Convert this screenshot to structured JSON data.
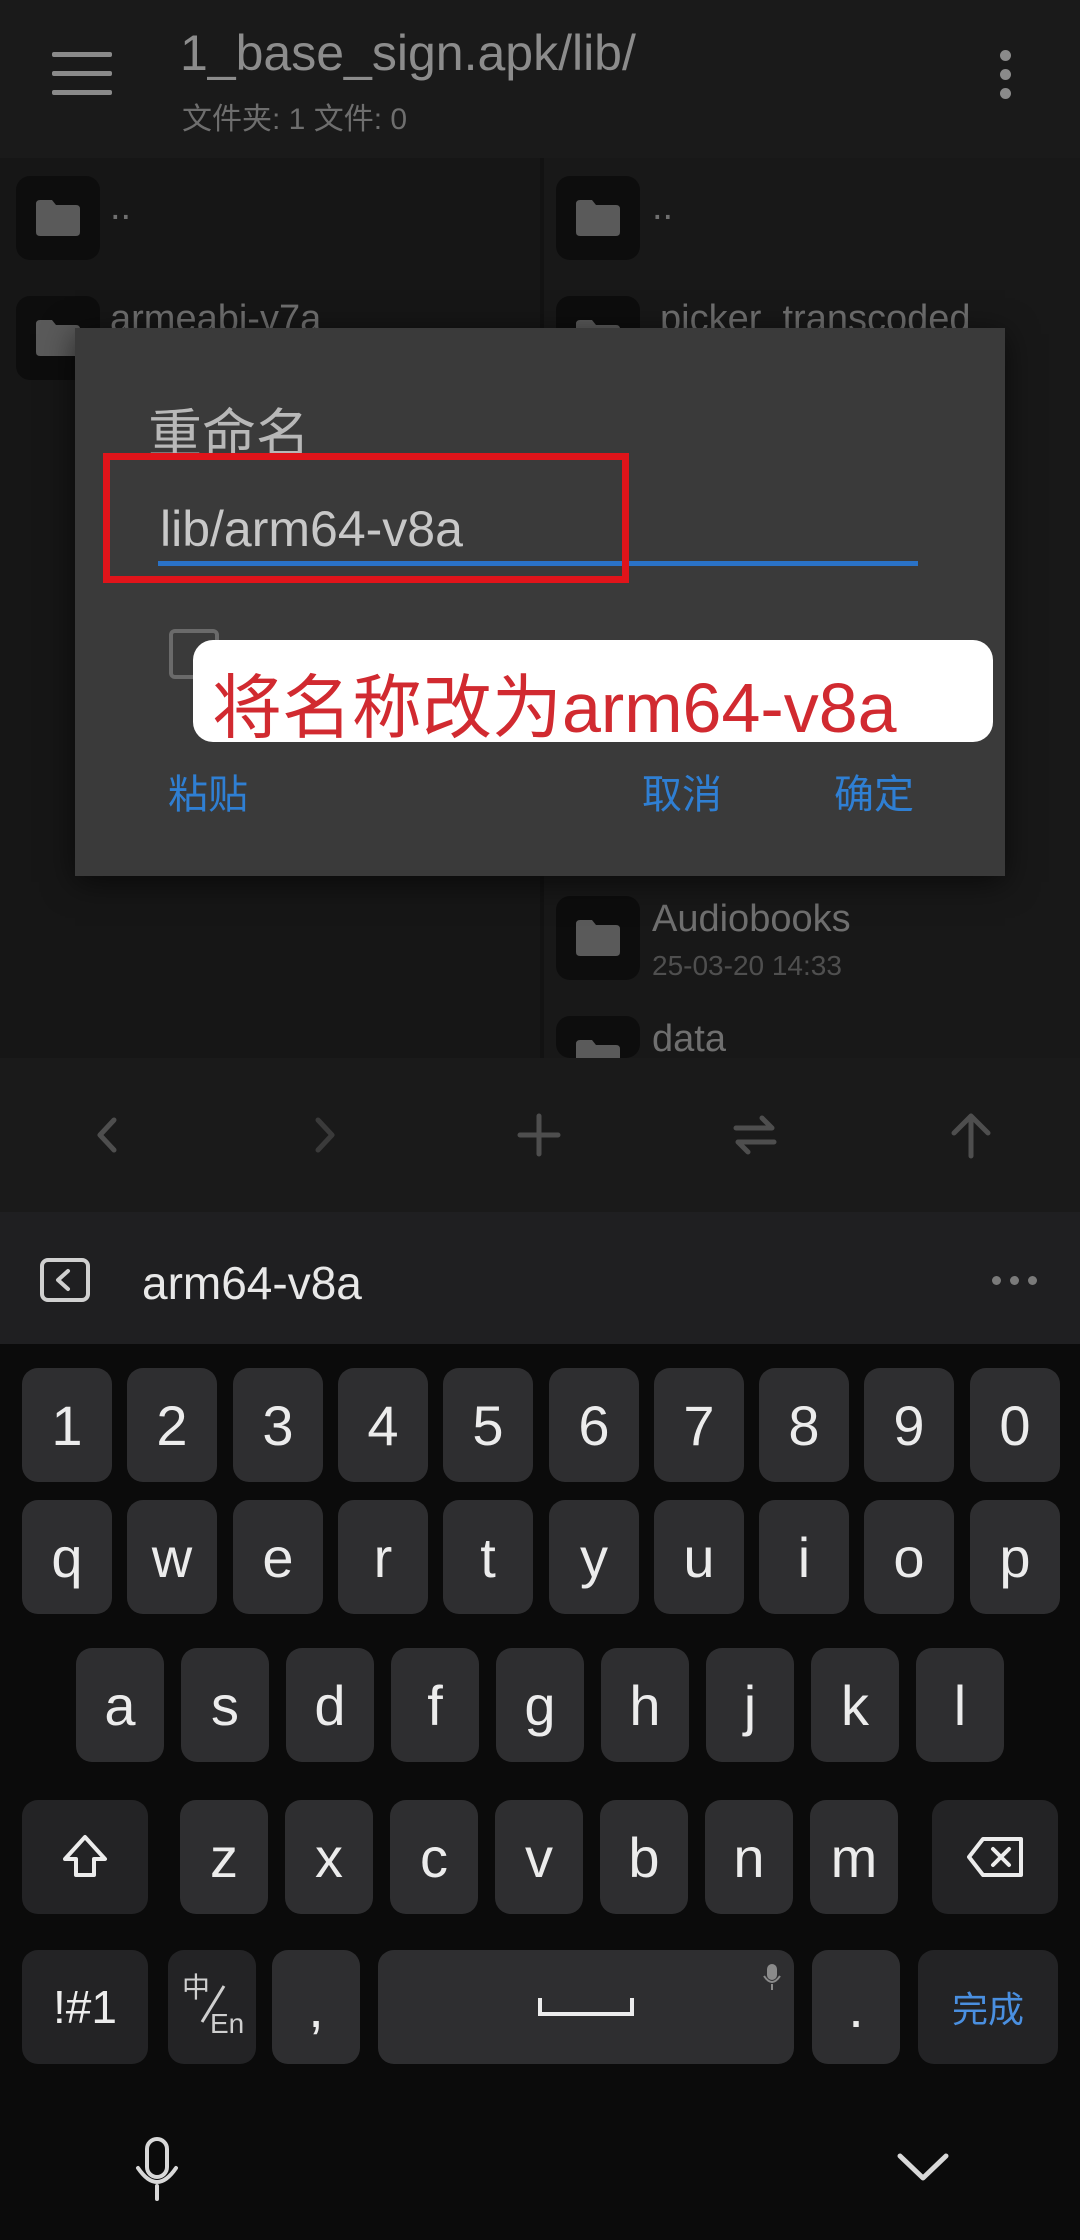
{
  "header": {
    "title": "1_base_sign.apk/lib/",
    "subtitle": "文件夹: 1  文件: 0"
  },
  "left_pane": {
    "rows": [
      {
        "name": ".."
      },
      {
        "name": "armeabi-v7a"
      }
    ]
  },
  "right_pane": {
    "rows": [
      {
        "name": "..",
        "date": ""
      },
      {
        "name": "picker_transcoded",
        "date": ""
      },
      {
        "name": "Audiobooks",
        "date": "25-03-20 14:33"
      },
      {
        "name": "data",
        "date": ""
      }
    ]
  },
  "dialog": {
    "title": "重命名",
    "input_value": "lib/arm64-v8a",
    "checkbox_label": "",
    "paste_label": "粘贴",
    "cancel_label": "取消",
    "ok_label": "确定"
  },
  "annotation": {
    "text": "将名称改为arm64-v8a",
    "highlight_color": "#e0141a"
  },
  "keyboard": {
    "suggestion": "arm64-v8a",
    "row_numbers": [
      "1",
      "2",
      "3",
      "4",
      "5",
      "6",
      "7",
      "8",
      "9",
      "0"
    ],
    "row_1": [
      "q",
      "w",
      "e",
      "r",
      "t",
      "y",
      "u",
      "i",
      "o",
      "p"
    ],
    "row_2": [
      "a",
      "s",
      "d",
      "f",
      "g",
      "h",
      "j",
      "k",
      "l"
    ],
    "row_3": [
      "z",
      "x",
      "c",
      "v",
      "b",
      "n",
      "m"
    ],
    "symbols_label": "!#1",
    "lang_top": "中",
    "lang_bottom": "En",
    "comma": ",",
    "period": ".",
    "done_label": "完成"
  },
  "colors": {
    "accent": "#2f7fd3",
    "input_underline": "#2a72c6",
    "callout_text": "#d12a30"
  },
  "icons": [
    "menu-icon",
    "more-vert-icon",
    "folder-icon",
    "back-arrow-icon",
    "forward-arrow-icon",
    "plus-icon",
    "swap-icon",
    "up-arrow-icon",
    "keyboard-back-icon",
    "shift-icon",
    "backspace-icon",
    "mic-icon",
    "space-icon",
    "chevron-down-icon"
  ]
}
